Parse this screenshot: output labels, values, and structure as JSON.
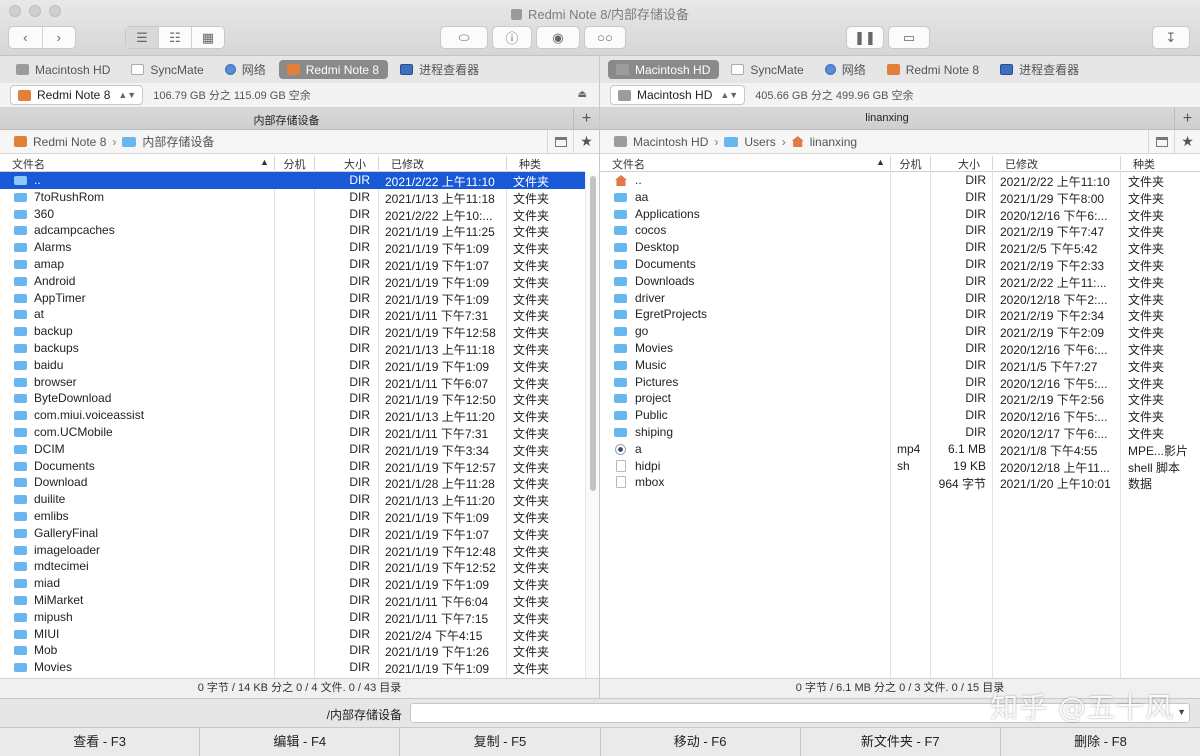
{
  "window": {
    "title": "Redmi Note 8/内部存储设备"
  },
  "left": {
    "devices": [
      {
        "name": "Macintosh HD",
        "icon": "hd",
        "active": false
      },
      {
        "name": "SyncMate",
        "icon": "sync",
        "active": false
      },
      {
        "name": "网络",
        "icon": "net",
        "active": false
      },
      {
        "name": "Redmi Note 8",
        "icon": "phone",
        "active": true
      },
      {
        "name": "进程查看器",
        "icon": "mon",
        "active": false
      }
    ],
    "volume": "Redmi Note 8",
    "free": "106.79 GB 分之 115.09 GB 空余",
    "header": "内部存储设备",
    "path": [
      "Redmi Note 8",
      "内部存储设备"
    ],
    "columns": {
      "name": "文件名",
      "ext": "分机",
      "size": "大小",
      "date": "已修改",
      "kind": "种类"
    },
    "rows": [
      {
        "name": "..",
        "ext": "",
        "size": "DIR",
        "date": "2021/2/22 上午11:10",
        "kind": "文件夹",
        "sel": true
      },
      {
        "name": "7toRushRom",
        "ext": "",
        "size": "DIR",
        "date": "2021/1/13 上午11:18",
        "kind": "文件夹"
      },
      {
        "name": "360",
        "ext": "",
        "size": "DIR",
        "date": "2021/2/22 上午10:...",
        "kind": "文件夹"
      },
      {
        "name": "adcampcaches",
        "ext": "",
        "size": "DIR",
        "date": "2021/1/19 上午11:25",
        "kind": "文件夹"
      },
      {
        "name": "Alarms",
        "ext": "",
        "size": "DIR",
        "date": "2021/1/19 下午1:09",
        "kind": "文件夹"
      },
      {
        "name": "amap",
        "ext": "",
        "size": "DIR",
        "date": "2021/1/19 下午1:07",
        "kind": "文件夹"
      },
      {
        "name": "Android",
        "ext": "",
        "size": "DIR",
        "date": "2021/1/19 下午1:09",
        "kind": "文件夹"
      },
      {
        "name": "AppTimer",
        "ext": "",
        "size": "DIR",
        "date": "2021/1/19 下午1:09",
        "kind": "文件夹"
      },
      {
        "name": "at",
        "ext": "",
        "size": "DIR",
        "date": "2021/1/11 下午7:31",
        "kind": "文件夹"
      },
      {
        "name": "backup",
        "ext": "",
        "size": "DIR",
        "date": "2021/1/19 下午12:58",
        "kind": "文件夹"
      },
      {
        "name": "backups",
        "ext": "",
        "size": "DIR",
        "date": "2021/1/13 上午11:18",
        "kind": "文件夹"
      },
      {
        "name": "baidu",
        "ext": "",
        "size": "DIR",
        "date": "2021/1/19 下午1:09",
        "kind": "文件夹"
      },
      {
        "name": "browser",
        "ext": "",
        "size": "DIR",
        "date": "2021/1/11 下午6:07",
        "kind": "文件夹"
      },
      {
        "name": "ByteDownload",
        "ext": "",
        "size": "DIR",
        "date": "2021/1/19 下午12:50",
        "kind": "文件夹"
      },
      {
        "name": "com.miui.voiceassist",
        "ext": "",
        "size": "DIR",
        "date": "2021/1/13 上午11:20",
        "kind": "文件夹"
      },
      {
        "name": "com.UCMobile",
        "ext": "",
        "size": "DIR",
        "date": "2021/1/11 下午7:31",
        "kind": "文件夹"
      },
      {
        "name": "DCIM",
        "ext": "",
        "size": "DIR",
        "date": "2021/1/19 下午3:34",
        "kind": "文件夹"
      },
      {
        "name": "Documents",
        "ext": "",
        "size": "DIR",
        "date": "2021/1/19 下午12:57",
        "kind": "文件夹"
      },
      {
        "name": "Download",
        "ext": "",
        "size": "DIR",
        "date": "2021/1/28 上午11:28",
        "kind": "文件夹"
      },
      {
        "name": "duilite",
        "ext": "",
        "size": "DIR",
        "date": "2021/1/13 上午11:20",
        "kind": "文件夹"
      },
      {
        "name": "emlibs",
        "ext": "",
        "size": "DIR",
        "date": "2021/1/19 下午1:09",
        "kind": "文件夹"
      },
      {
        "name": "GalleryFinal",
        "ext": "",
        "size": "DIR",
        "date": "2021/1/19 下午1:07",
        "kind": "文件夹"
      },
      {
        "name": "imageloader",
        "ext": "",
        "size": "DIR",
        "date": "2021/1/19 下午12:48",
        "kind": "文件夹"
      },
      {
        "name": "mdtecimei",
        "ext": "",
        "size": "DIR",
        "date": "2021/1/19 下午12:52",
        "kind": "文件夹"
      },
      {
        "name": "miad",
        "ext": "",
        "size": "DIR",
        "date": "2021/1/19 下午1:09",
        "kind": "文件夹"
      },
      {
        "name": "MiMarket",
        "ext": "",
        "size": "DIR",
        "date": "2021/1/11 下午6:04",
        "kind": "文件夹"
      },
      {
        "name": "mipush",
        "ext": "",
        "size": "DIR",
        "date": "2021/1/11 下午7:15",
        "kind": "文件夹"
      },
      {
        "name": "MIUI",
        "ext": "",
        "size": "DIR",
        "date": "2021/2/4 下午4:15",
        "kind": "文件夹"
      },
      {
        "name": "Mob",
        "ext": "",
        "size": "DIR",
        "date": "2021/1/19 下午1:26",
        "kind": "文件夹"
      },
      {
        "name": "Movies",
        "ext": "",
        "size": "DIR",
        "date": "2021/1/19 下午1:09",
        "kind": "文件夹"
      }
    ],
    "status": "0 字节 / 14 KB 分之 0 / 4 文件. 0 / 43 目录"
  },
  "right": {
    "devices": [
      {
        "name": "Macintosh HD",
        "icon": "hd",
        "active": true
      },
      {
        "name": "SyncMate",
        "icon": "sync",
        "active": false
      },
      {
        "name": "网络",
        "icon": "net",
        "active": false
      },
      {
        "name": "Redmi Note 8",
        "icon": "phone",
        "active": false
      },
      {
        "name": "进程查看器",
        "icon": "mon",
        "active": false
      }
    ],
    "volume": "Macintosh HD",
    "free": "405.66 GB 分之 499.96 GB 空余",
    "header": "linanxing",
    "path": [
      "Macintosh HD",
      "Users",
      "linanxing"
    ],
    "columns": {
      "name": "文件名",
      "ext": "分机",
      "size": "大小",
      "date": "已修改",
      "kind": "种类"
    },
    "rows": [
      {
        "name": "..",
        "ext": "",
        "size": "DIR",
        "date": "2021/2/22 上午11:10",
        "kind": "文件夹",
        "icon": "up"
      },
      {
        "name": "aa",
        "ext": "",
        "size": "DIR",
        "date": "2021/1/29 下午8:00",
        "kind": "文件夹"
      },
      {
        "name": "Applications",
        "ext": "",
        "size": "DIR",
        "date": "2020/12/16 下午6:...",
        "kind": "文件夹"
      },
      {
        "name": "cocos",
        "ext": "",
        "size": "DIR",
        "date": "2021/2/19 下午7:47",
        "kind": "文件夹"
      },
      {
        "name": "Desktop",
        "ext": "",
        "size": "DIR",
        "date": "2021/2/5 下午5:42",
        "kind": "文件夹"
      },
      {
        "name": "Documents",
        "ext": "",
        "size": "DIR",
        "date": "2021/2/19 下午2:33",
        "kind": "文件夹"
      },
      {
        "name": "Downloads",
        "ext": "",
        "size": "DIR",
        "date": "2021/2/22 上午11:...",
        "kind": "文件夹"
      },
      {
        "name": "driver",
        "ext": "",
        "size": "DIR",
        "date": "2020/12/18 下午2:...",
        "kind": "文件夹"
      },
      {
        "name": "EgretProjects",
        "ext": "",
        "size": "DIR",
        "date": "2021/2/19 下午2:34",
        "kind": "文件夹"
      },
      {
        "name": "go",
        "ext": "",
        "size": "DIR",
        "date": "2021/2/19 下午2:09",
        "kind": "文件夹"
      },
      {
        "name": "Movies",
        "ext": "",
        "size": "DIR",
        "date": "2020/12/16 下午6:...",
        "kind": "文件夹"
      },
      {
        "name": "Music",
        "ext": "",
        "size": "DIR",
        "date": "2021/1/5 下午7:27",
        "kind": "文件夹"
      },
      {
        "name": "Pictures",
        "ext": "",
        "size": "DIR",
        "date": "2020/12/16 下午5:...",
        "kind": "文件夹"
      },
      {
        "name": "project",
        "ext": "",
        "size": "DIR",
        "date": "2021/2/19 下午2:56",
        "kind": "文件夹"
      },
      {
        "name": "Public",
        "ext": "",
        "size": "DIR",
        "date": "2020/12/16 下午5:...",
        "kind": "文件夹"
      },
      {
        "name": "shiping",
        "ext": "",
        "size": "DIR",
        "date": "2020/12/17 下午6:...",
        "kind": "文件夹"
      },
      {
        "name": "a",
        "ext": "mp4",
        "size": "6.1 MB",
        "date": "2021/1/8 下午4:55",
        "kind": "MPE...影片",
        "icon": "media"
      },
      {
        "name": "hidpi",
        "ext": "sh",
        "size": "19 KB",
        "date": "2020/12/18 上午11...",
        "kind": "shell 脚本",
        "icon": "file"
      },
      {
        "name": "mbox",
        "ext": "",
        "size": "964 字节",
        "date": "2021/1/20 上午10:01",
        "kind": "数据",
        "icon": "file"
      }
    ],
    "status": "0 字节 / 6.1 MB 分之 0 / 3 文件. 0 / 15 目录"
  },
  "command": {
    "prompt": "/内部存储设备",
    "value": ""
  },
  "fkeys": [
    "查看 - F3",
    "编辑 - F4",
    "复制 - F5",
    "移动 - F6",
    "新文件夹 - F7",
    "删除 - F8"
  ],
  "watermark": "知乎 @五十风"
}
